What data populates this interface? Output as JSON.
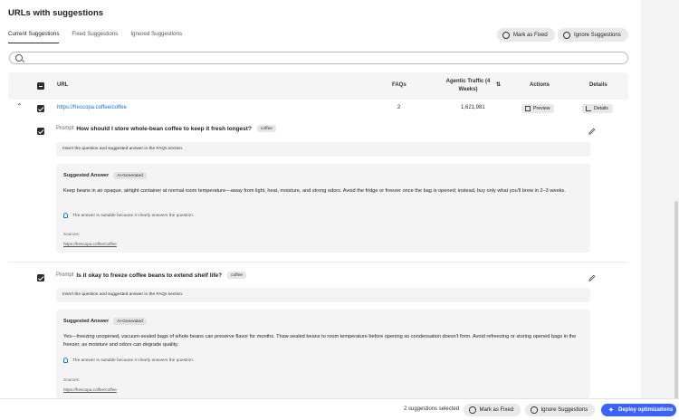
{
  "page": {
    "title": "URLs with suggestions"
  },
  "tabs": [
    {
      "label": "Current Suggestions",
      "active": true
    },
    {
      "label": "Fixed Suggestions",
      "active": false
    },
    {
      "label": "Ignored Suggestions",
      "active": false
    }
  ],
  "header_actions": {
    "mark_fixed": "Mark as Fixed",
    "ignore": "Ignore Suggestions"
  },
  "search": {
    "placeholder": "",
    "value": ""
  },
  "table": {
    "columns": {
      "url": "URL",
      "faqs": "FAQs",
      "traffic": "Agentic Traffic (4 Weeks)",
      "actions": "Actions",
      "details": "Details"
    },
    "row": {
      "url": "https://frescopa.coffee/coffee",
      "faqs": "2",
      "traffic": "1,621,981",
      "preview": "Preview",
      "details": "Details"
    }
  },
  "suggestions": [
    {
      "prompt_label": "Prompt",
      "question": "How should I store whole-bean coffee to keep it fresh longest?",
      "tag": "coffee",
      "instruction": "Insert the question and suggested answer in the FAQs section.",
      "answer_title": "Suggested Answer",
      "ai_tag": "AI-Generated",
      "answer": "Keep beans in an opaque, airtight container at normal room temperature—away from light, heat, moisture, and strong odors. Avoid the fridge or freezer once the bag is opened; instead, buy only what you'll brew in 2–3 weeks.",
      "reason": "The answer is suitable because it clearly answers the question.",
      "sources_label": "Sources:",
      "source": "https://frescopa.coffee/coffee"
    },
    {
      "prompt_label": "Prompt",
      "question": "Is it okay to freeze coffee beans to extend shelf life?",
      "tag": "coffee",
      "instruction": "Insert the question and suggested answer in the FAQs section.",
      "answer_title": "Suggested Answer",
      "ai_tag": "AI-Generated",
      "answer": "Yes—freezing unopened, vacuum-sealed bags of whole beans can preserve flavor for months. Thaw sealed beans to room temperature before opening so condensation doesn't form. Avoid refreezing or storing opened bags in the freezer, as moisture and odors can degrade quality.",
      "reason": "The answer is suitable because it clearly answers the question.",
      "sources_label": "Sources:",
      "source": "https://frescopa.coffee/coffee"
    }
  ],
  "bottom_bar": {
    "selected_count": "2 suggestions selected",
    "mark_fixed": "Mark as Fixed",
    "ignore": "Ignore Suggestions",
    "deploy": "Deploy optimizations"
  },
  "colors": {
    "accent": "#1473e6",
    "deploy": "#3b63fb",
    "dark": "#2c2c2c"
  }
}
